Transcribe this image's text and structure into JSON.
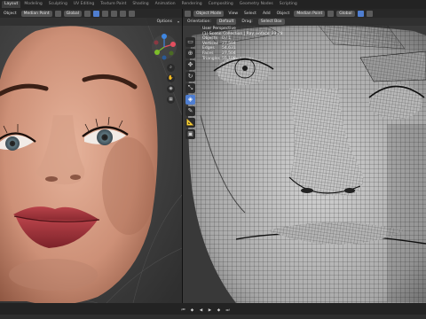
{
  "workspace_tabs": [
    "Layout",
    "Modeling",
    "Sculpting",
    "UV Editing",
    "Texture Paint",
    "Shading",
    "Animation",
    "Rendering",
    "Compositing",
    "Geometry Nodes",
    "Scripting"
  ],
  "active_tab_index": 0,
  "left_viewport": {
    "header": {
      "menu_object": "Object",
      "pivot": "Median Point",
      "transform": "Global",
      "options": "Options"
    }
  },
  "right_viewport": {
    "header": {
      "mode": "Object Mode",
      "menus": [
        "View",
        "Select",
        "Add",
        "Object"
      ],
      "pivot": "Median Point",
      "transform": "Global"
    },
    "sub_header": {
      "orientation_label": "Orientation:",
      "orientation_value": "Default",
      "drag_label": "Drag:",
      "drag_value": "Select Box"
    },
    "overlay": {
      "view_name": "User Perspective",
      "collection_line": "(1) Scene Collection | Ray_onface_23.28",
      "stats": [
        {
          "label": "Objects",
          "value": "0 / 1"
        },
        {
          "label": "Vertices",
          "value": "27,594"
        },
        {
          "label": "Edges",
          "value": "54,631"
        },
        {
          "label": "Faces",
          "value": "27,504"
        },
        {
          "label": "Triangles",
          "value": "55,108"
        }
      ]
    }
  },
  "colors": {
    "accent_blue": "#4f7ed0",
    "gizmo_x": "#e24f5f",
    "gizmo_y": "#7dbd2a",
    "gizmo_z": "#3f86e0",
    "wire": "#111111",
    "mesh_light": "#c9c9c9",
    "skin_base": "#d49a80",
    "lip": "#a8353b"
  },
  "playback_icons": [
    "jump-start-icon",
    "prev-keyframe-icon",
    "play-reverse-icon",
    "play-icon",
    "next-keyframe-icon",
    "jump-end-icon"
  ]
}
